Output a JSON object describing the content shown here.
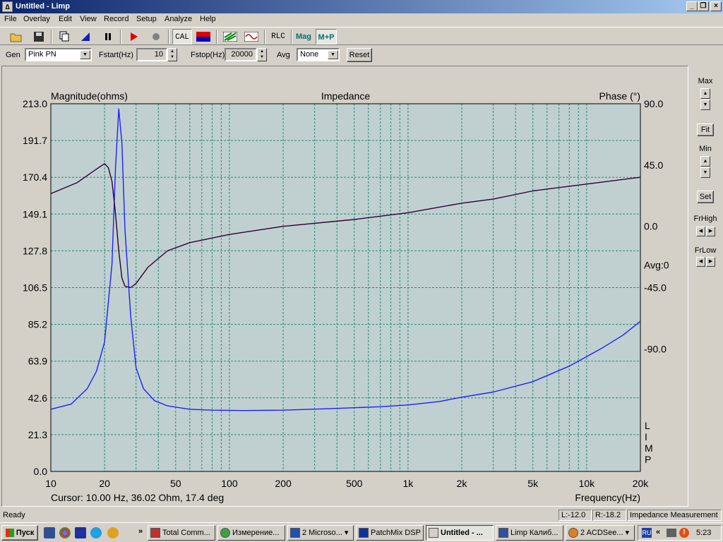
{
  "window": {
    "title": "Untitled - Limp",
    "app_icon": "limp-app-icon"
  },
  "menu": [
    "File",
    "Overlay",
    "Edit",
    "View",
    "Record",
    "Setup",
    "Analyze",
    "Help"
  ],
  "toolbar": {
    "cal_label": "CAL",
    "rlc_label": "RLC",
    "mag_label": "Mag",
    "mp_label": "M+P"
  },
  "params": {
    "gen_label": "Gen",
    "gen_value": "Pink PN",
    "fstart_label": "Fstart(Hz)",
    "fstart_value": "10",
    "fstop_label": "Fstop(Hz)",
    "fstop_value": "20000",
    "avg_label": "Avg",
    "avg_value": "None",
    "reset_label": "Reset"
  },
  "side": {
    "max_label": "Max",
    "fit_label": "Fit",
    "min_label": "Min",
    "set_label": "Set",
    "frhigh_label": "FrHigh",
    "frlow_label": "FrLow"
  },
  "chart_data": {
    "type": "line",
    "title": "Impedance",
    "ylabel": "Magnitude(ohms)",
    "y2label": "Phase (°)",
    "xlabel": "Frequency(Hz)",
    "xscale": "log",
    "xlim": [
      10,
      20000
    ],
    "ylim": [
      0,
      213
    ],
    "y2lim": [
      -180,
      90
    ],
    "yticks": [
      "0.0",
      "21.3",
      "42.6",
      "63.9",
      "85.2",
      "106.5",
      "127.8",
      "149.1",
      "170.4",
      "191.7",
      "213.0"
    ],
    "y2ticks": [
      "90.0",
      "45.0",
      "0.0",
      "-45.0",
      "-90.0"
    ],
    "avg_label": "Avg:0",
    "limp_mark": [
      "L",
      "I",
      "M",
      "P"
    ],
    "xticks": [
      {
        "v": 10,
        "label": "10"
      },
      {
        "v": 20,
        "label": "20"
      },
      {
        "v": 50,
        "label": "50"
      },
      {
        "v": 100,
        "label": "100"
      },
      {
        "v": 200,
        "label": "200"
      },
      {
        "v": 500,
        "label": "500"
      },
      {
        "v": 1000,
        "label": "1k"
      },
      {
        "v": 2000,
        "label": "2k"
      },
      {
        "v": 5000,
        "label": "5k"
      },
      {
        "v": 10000,
        "label": "10k"
      },
      {
        "v": 20000,
        "label": "20k"
      }
    ],
    "grid": true,
    "series": [
      {
        "color": "#1f1fff",
        "points": [
          [
            10,
            36
          ],
          [
            13,
            39
          ],
          [
            16,
            48
          ],
          [
            18,
            58
          ],
          [
            20,
            75
          ],
          [
            22,
            120
          ],
          [
            23,
            175
          ],
          [
            24,
            210
          ],
          [
            25,
            190
          ],
          [
            26,
            140
          ],
          [
            28,
            90
          ],
          [
            30,
            60
          ],
          [
            33,
            48
          ],
          [
            38,
            41
          ],
          [
            45,
            38
          ],
          [
            60,
            36
          ],
          [
            80,
            35.5
          ],
          [
            120,
            35.3
          ],
          [
            200,
            35.5
          ],
          [
            400,
            36.5
          ],
          [
            700,
            37.5
          ],
          [
            1000,
            38.5
          ],
          [
            1500,
            40.5
          ],
          [
            2000,
            43
          ],
          [
            3000,
            46
          ],
          [
            5000,
            52
          ],
          [
            8000,
            61
          ],
          [
            12000,
            71
          ],
          [
            16000,
            79
          ],
          [
            20000,
            87
          ]
        ]
      },
      {
        "color": "#300030",
        "axis": "y2",
        "points": [
          [
            10,
            24
          ],
          [
            14,
            32
          ],
          [
            18,
            42
          ],
          [
            20,
            46
          ],
          [
            21,
            43
          ],
          [
            22,
            33
          ],
          [
            23,
            10
          ],
          [
            24,
            -18
          ],
          [
            25,
            -38
          ],
          [
            26,
            -44
          ],
          [
            28,
            -45
          ],
          [
            30,
            -42
          ],
          [
            35,
            -30
          ],
          [
            45,
            -18
          ],
          [
            60,
            -12
          ],
          [
            100,
            -6
          ],
          [
            200,
            0
          ],
          [
            500,
            5
          ],
          [
            1000,
            10
          ],
          [
            2000,
            17
          ],
          [
            3000,
            20
          ],
          [
            5000,
            26
          ],
          [
            10000,
            31
          ],
          [
            20000,
            36
          ]
        ]
      }
    ]
  },
  "cursor_readout": "Cursor: 10.00 Hz, 36.02 Ohm, 17.4 deg",
  "status": {
    "ready": "Ready",
    "left": "L:-12.0",
    "right": "R:-18.2",
    "mode": "Impedance Measurement"
  },
  "taskbar": {
    "start": "Пуск",
    "tasks": [
      {
        "label": "Total Comm..."
      },
      {
        "label": "Измерение..."
      },
      {
        "label": "2 Microso..."
      },
      {
        "label": "PatchMix DSP"
      },
      {
        "label": "Untitled - ..."
      },
      {
        "label": "Limp Калиб..."
      },
      {
        "label": "2 ACDSee..."
      }
    ],
    "lang": "RU",
    "clock": "5:23"
  }
}
